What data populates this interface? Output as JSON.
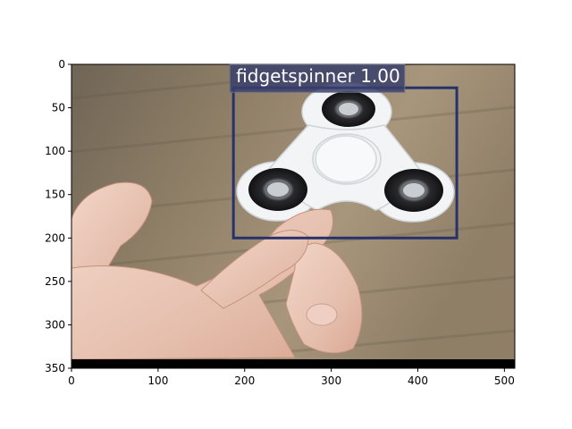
{
  "figure": {
    "x_axis": {
      "range": [
        0,
        512
      ],
      "ticks": [
        0,
        100,
        200,
        300,
        400,
        500
      ],
      "tick_labels": [
        "0",
        "100",
        "200",
        "300",
        "400",
        "500"
      ]
    },
    "y_axis": {
      "range": [
        0,
        350
      ],
      "inverted": true,
      "ticks": [
        0,
        50,
        100,
        150,
        200,
        250,
        300,
        350
      ],
      "tick_labels": [
        "0",
        "50",
        "100",
        "150",
        "200",
        "250",
        "300",
        "350"
      ]
    }
  },
  "detection": {
    "label": "fidgetspinner 1.00",
    "class_name": "fidgetspinner",
    "score": 1.0,
    "box": {
      "xmin": 187,
      "ymin": 27,
      "xmax": 445,
      "ymax": 200
    },
    "box_color": "#27326b",
    "label_bg_color": "#3a3f6b"
  },
  "image_content": {
    "description_icon": "hand-holding-fidget-spinner-photo",
    "colors": {
      "background_wood": "#8a7a63",
      "spinner_white": "#f2f4f5",
      "bearing_dark": "#1c1c1e",
      "skin": "#e8c3b2",
      "bottom_padding": "#000000"
    }
  }
}
